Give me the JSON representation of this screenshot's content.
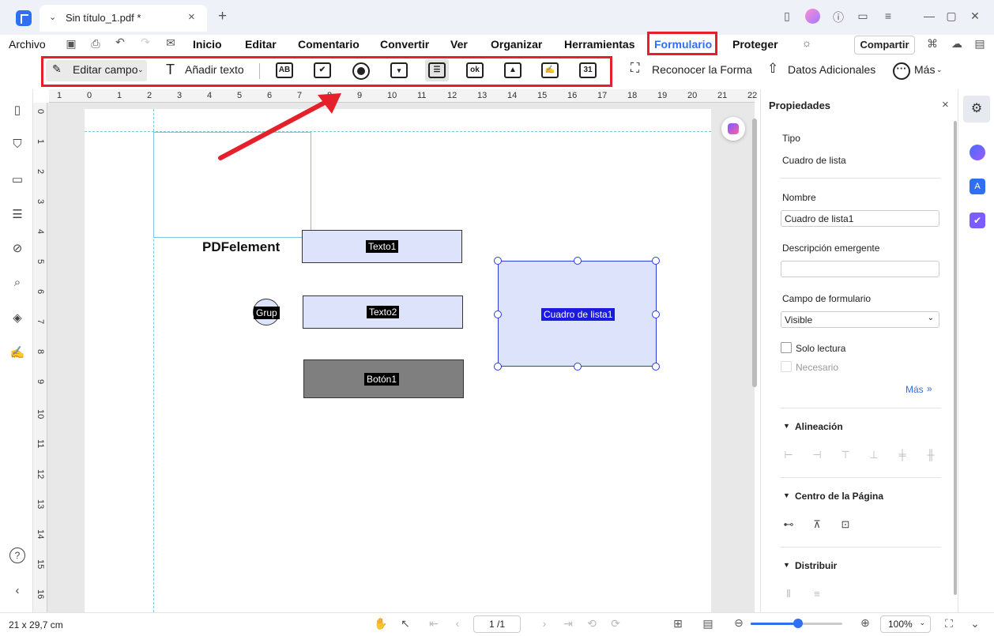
{
  "window": {
    "tab_title": "Sin título_1.pdf *"
  },
  "menu": {
    "file": "Archivo",
    "items": [
      "Inicio",
      "Editar",
      "Comentario",
      "Convertir",
      "Ver",
      "Organizar",
      "Herramientas",
      "Formulario",
      "Proteger"
    ],
    "share": "Compartir"
  },
  "toolbar": {
    "edit_field": "Editar campo",
    "add_text": "Añadir texto",
    "recognize": "Reconocer la Forma",
    "additional_data": "Datos Adicionales",
    "more": "Más",
    "field_icons": [
      "text-field-icon",
      "checkbox-icon",
      "radio-icon",
      "dropdown-icon",
      "listbox-icon",
      "button-icon",
      "image-field-icon",
      "signature-field-icon",
      "date-field-icon"
    ]
  },
  "ruler_h": [
    "1",
    "0",
    "1",
    "2",
    "3",
    "4",
    "5",
    "6",
    "7",
    "8",
    "9",
    "10",
    "11",
    "12",
    "13",
    "14",
    "15",
    "16",
    "17",
    "18",
    "19",
    "20",
    "21",
    "22"
  ],
  "ruler_v": [
    "0",
    "1",
    "2",
    "3",
    "4",
    "5",
    "6",
    "7",
    "8",
    "9",
    "10",
    "11",
    "12",
    "13",
    "14",
    "15",
    "16"
  ],
  "document": {
    "heading": "PDFelement",
    "fields": {
      "text1": "Texto1",
      "text2": "Texto2",
      "group": "Grup",
      "button1": "Botón1",
      "listbox1": "Cuadro de lista1"
    }
  },
  "properties": {
    "title": "Propiedades",
    "type_label": "Tipo",
    "type_value": "Cuadro de lista",
    "name_label": "Nombre",
    "name_value": "Cuadro de lista1",
    "tooltip_label": "Descripción emergente",
    "tooltip_value": "",
    "form_field_label": "Campo de formulario",
    "form_field_value": "Visible",
    "readonly_label": "Solo lectura",
    "required_label": "Necesario",
    "more_label": "Más",
    "alignment_label": "Alineación",
    "page_center_label": "Centro de la Página",
    "distribute_label": "Distribuir"
  },
  "status": {
    "page_size": "21 x 29,7 cm",
    "page_number": "1 /1",
    "zoom": "100%",
    "zoom_level": 0.52
  },
  "colors": {
    "accent": "#2f6ff2",
    "highlight_box": "#e5202a",
    "field_fill": "#dde3fb"
  }
}
